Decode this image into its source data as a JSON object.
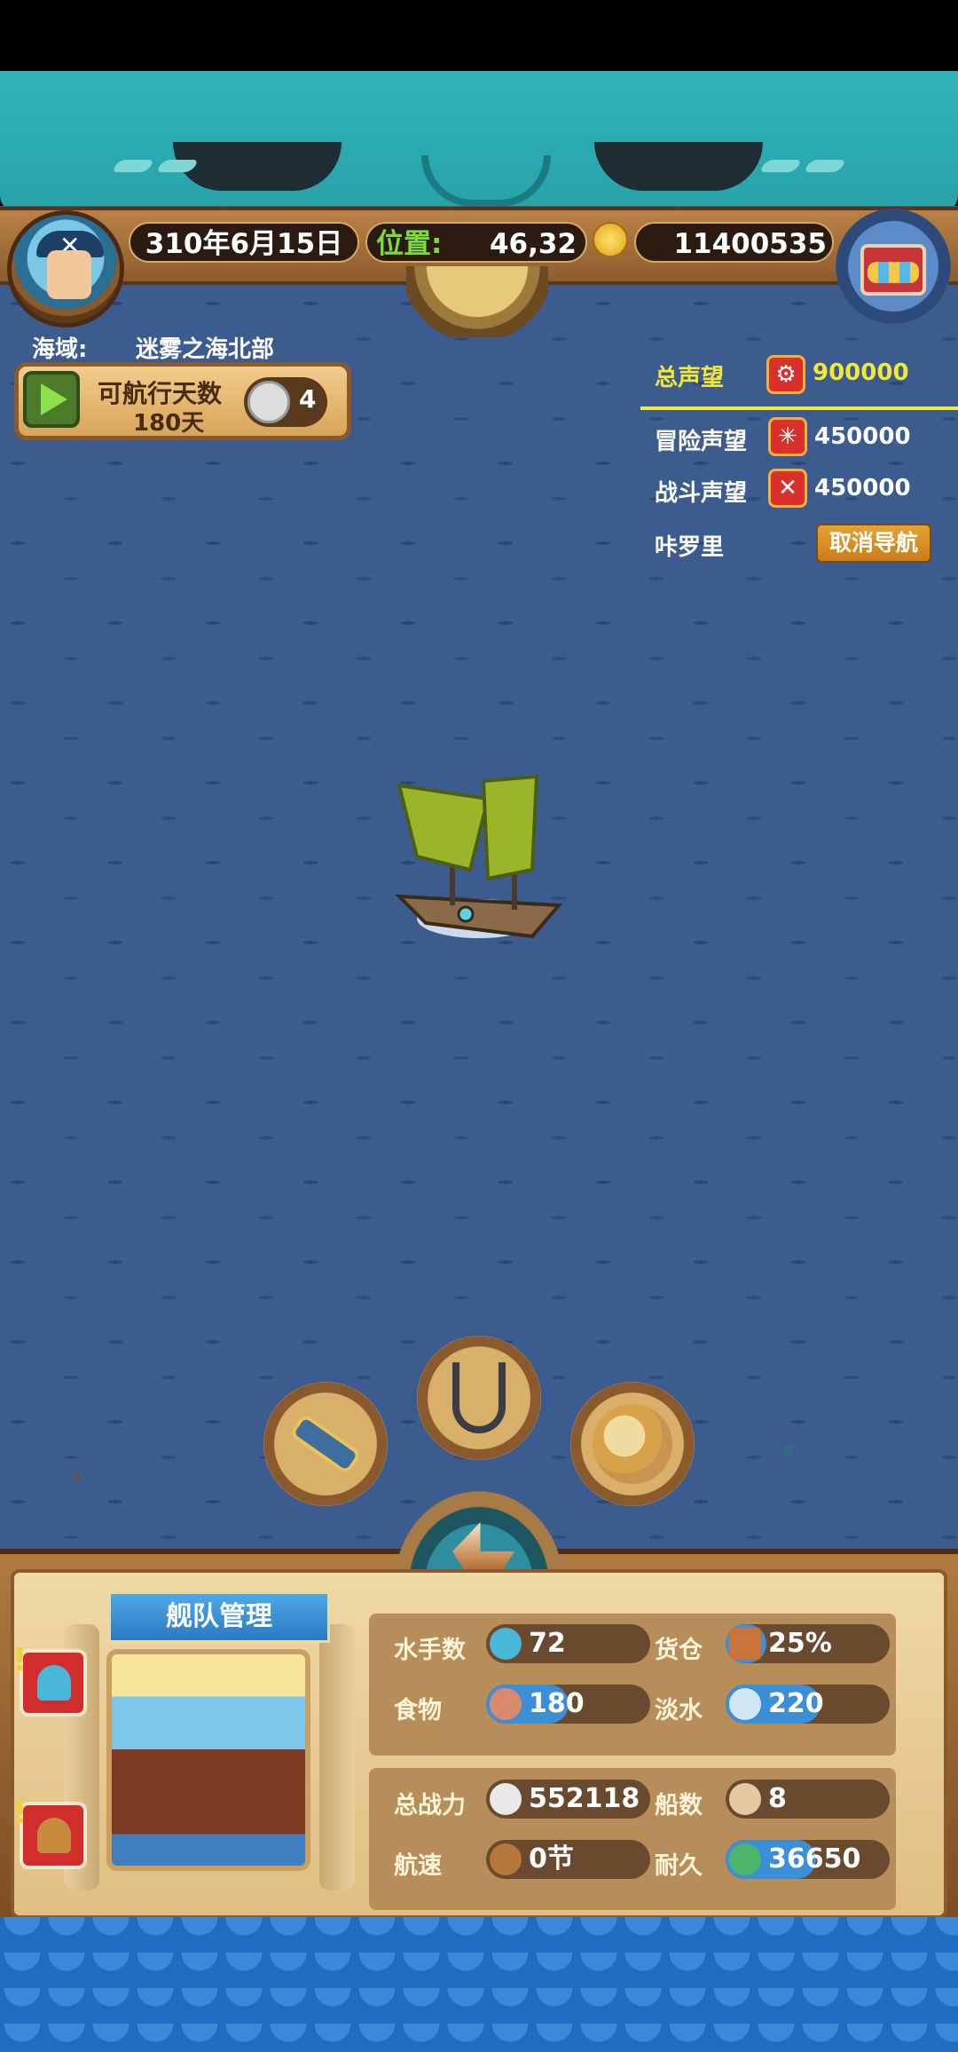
{
  "header": {
    "date": "310年6月15日",
    "location_label": "位置:",
    "location_value": "46,32",
    "gold": "11400535"
  },
  "sea_area": {
    "label": "海域:",
    "name": "迷雾之海北部"
  },
  "sailing": {
    "label": "可航行天数",
    "days": "180天",
    "compass_value": "4"
  },
  "reputation": {
    "total_label": "总声望",
    "total_value": "900000",
    "adventure_label": "冒险声望",
    "adventure_value": "450000",
    "battle_label": "战斗声望",
    "battle_value": "450000",
    "destination": "咔罗里",
    "cancel_nav": "取消导航"
  },
  "fleet": {
    "title": "舰队管理",
    "stats": [
      {
        "label": "水手数",
        "value": "72",
        "fill": 0.0,
        "icon": "sailor-icon"
      },
      {
        "label": "货仓",
        "value": "25%",
        "fill": 0.25,
        "icon": "cargo-icon"
      },
      {
        "label": "食物",
        "value": "180",
        "fill": 0.5,
        "icon": "meat-icon"
      },
      {
        "label": "淡水",
        "value": "220",
        "fill": 0.58,
        "icon": "water-icon"
      },
      {
        "label": "总战力",
        "value": "552118",
        "fill": 0.0,
        "icon": "skull-icon"
      },
      {
        "label": "船数",
        "value": "8",
        "fill": 0.0,
        "icon": "ship-count-icon"
      },
      {
        "label": "航速",
        "value": "0节",
        "fill": 0.0,
        "icon": "speed-icon"
      },
      {
        "label": "耐久",
        "value": "36650",
        "fill": 0.55,
        "icon": "durability-icon"
      }
    ]
  },
  "colors": {
    "sea": "#3c5b8f",
    "gold_text": "#f2e83a",
    "bar_fill": "#3b8fd6",
    "location_label": "#7bdc3c"
  }
}
